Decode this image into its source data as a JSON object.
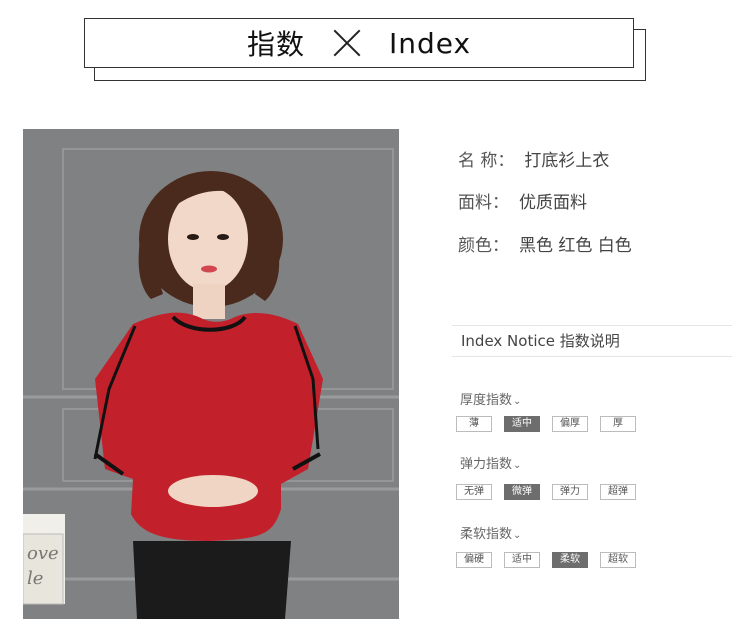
{
  "header": {
    "title_cn": "指数",
    "title_en": "Index"
  },
  "product": {
    "name_label": "名 称：",
    "name_value": "打底衫上衣",
    "fabric_label": "面料：",
    "fabric_value": "优质面料",
    "color_label": "颜色：",
    "color_value": "黑色 红色 白色"
  },
  "notice": {
    "title": "Index Notice 指数说明"
  },
  "groups": [
    {
      "title": "厚度指数",
      "options": [
        "薄",
        "适中",
        "偏厚",
        "厚"
      ],
      "selected": 1
    },
    {
      "title": "弹力指数",
      "options": [
        "无弹",
        "微弹",
        "弹力",
        "超弹"
      ],
      "selected": 1
    },
    {
      "title": "柔软指数",
      "options": [
        "偏硬",
        "适中",
        "柔软",
        "超软"
      ],
      "selected": 2
    }
  ],
  "colors": {
    "accent_selected": "#6d6d6d",
    "shirt_red": "#c2212c",
    "skirt": "#1b1b1b",
    "wall": "#7e7f81"
  }
}
